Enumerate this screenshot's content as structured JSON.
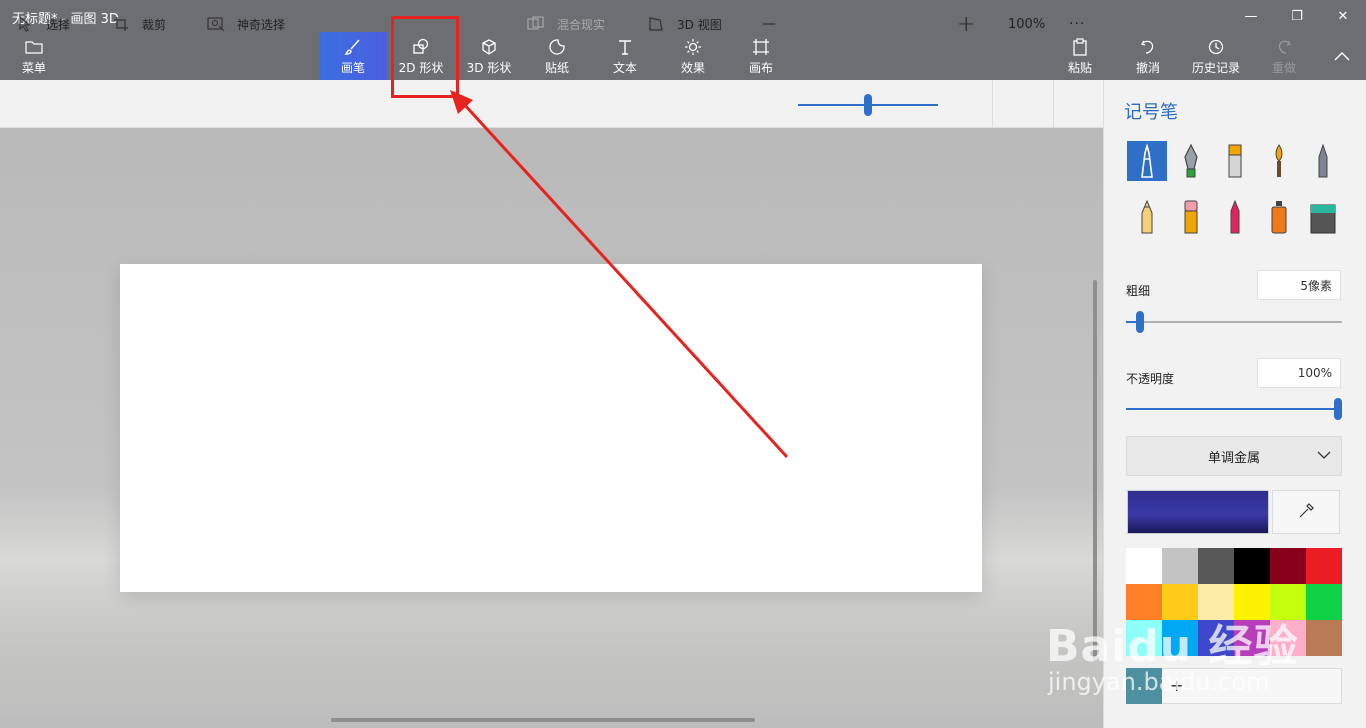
{
  "window": {
    "title": "无标题* - 画图 3D",
    "minimize_glyph": "—",
    "restore_glyph": "❐",
    "close_glyph": "✕"
  },
  "toolbar": {
    "menu_label": "菜单",
    "tools": [
      {
        "label": "画笔",
        "icon": "brush-icon",
        "active": true
      },
      {
        "label": "2D 形状",
        "icon": "2d-shapes-icon"
      },
      {
        "label": "3D 形状",
        "icon": "3d-shapes-icon"
      },
      {
        "label": "贴纸",
        "icon": "sticker-icon"
      },
      {
        "label": "文本",
        "icon": "text-icon"
      },
      {
        "label": "效果",
        "icon": "effects-icon"
      },
      {
        "label": "画布",
        "icon": "canvas-icon"
      }
    ],
    "right": [
      {
        "label": "粘贴",
        "icon": "paste-icon"
      },
      {
        "label": "撤消",
        "icon": "undo-icon"
      },
      {
        "label": "历史记录",
        "icon": "history-icon"
      },
      {
        "label": "重做",
        "icon": "redo-icon",
        "disabled": true
      }
    ]
  },
  "subtoolbar": {
    "select": "选择",
    "crop": "裁剪",
    "magic_select": "神奇选择",
    "mixed_reality": "混合现实",
    "view_3d": "3D 视图",
    "zoom_minus": "—",
    "zoom_plus": "+",
    "zoom_value": "100%",
    "zoom_level": 0.5,
    "more": "···"
  },
  "panel": {
    "title": "记号笔",
    "brushes": [
      "marker",
      "calligraphy-pen",
      "oil-brush",
      "watercolor",
      "pixel-pen",
      "pencil",
      "eraser",
      "crayon",
      "spray-can",
      "fill"
    ],
    "selected_brush": "marker",
    "thickness_label": "粗细",
    "thickness_value": "5像素",
    "thickness_level": 0.05,
    "opacity_label": "不透明度",
    "opacity_value": "100%",
    "opacity_level": 1.0,
    "material": "单调金属",
    "current_color": "#3b3aa8",
    "palette": [
      "#ffffff",
      "#c3c3c3",
      "#585858",
      "#000000",
      "#88001b",
      "#ec1c24",
      "#ff7f27",
      "#ffca18",
      "#fdeca6",
      "#fff200",
      "#c4ff0e",
      "#0ed145",
      "#8cfffb",
      "#00a8f3",
      "#3f48cc",
      "#b83dba",
      "#ffaec8",
      "#b97a56"
    ],
    "custom_color": "#4e8fa0",
    "add_color_glyph": "+"
  },
  "watermark": {
    "logo": "Baidu 经验",
    "url": "jingyan.baidu.com"
  },
  "accent": "#2f6fc7",
  "annotation_color": "#e8231f"
}
